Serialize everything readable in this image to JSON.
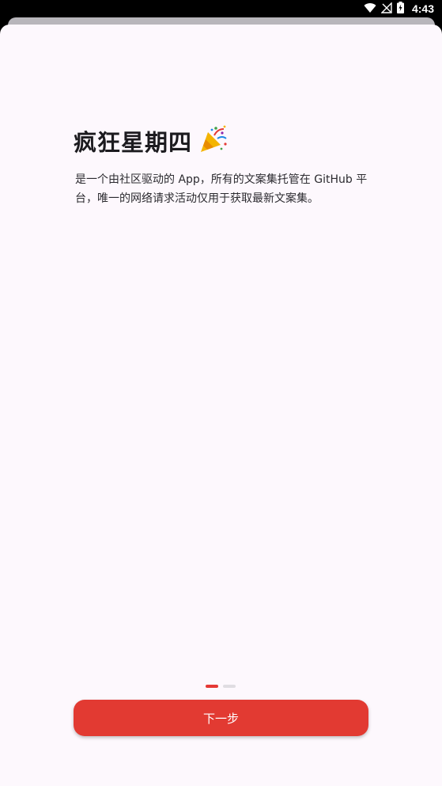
{
  "status_bar": {
    "time": "4:43",
    "icons": [
      "wifi-icon",
      "no-signal-icon",
      "battery-charging-icon"
    ]
  },
  "onboarding": {
    "title": "疯狂星期四",
    "title_icon": "party-popper-icon",
    "description": "是一个由社区驱动的 App，所有的文案集托管在 GitHub 平台，唯一的网络请求活动仅用于获取最新文案集。",
    "page_indicator": {
      "total": 2,
      "current": 1
    },
    "next_button_label": "下一步"
  },
  "colors": {
    "accent": "#e23a32",
    "background": "#fdf8fd",
    "title_text": "#1c1b1f"
  }
}
